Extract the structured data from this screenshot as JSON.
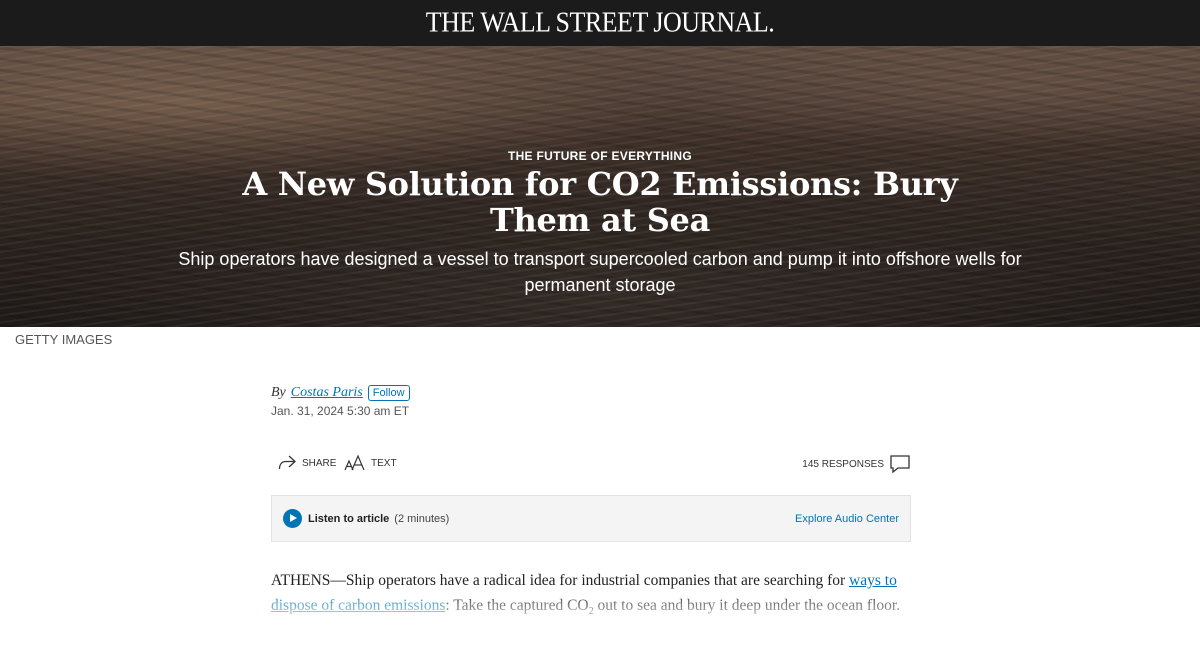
{
  "masthead": {
    "logo": "THE WALL STREET JOURNAL."
  },
  "hero": {
    "flashline": "THE FUTURE OF EVERYTHING",
    "headline": "A New Solution for CO2 Emissions: Bury Them at Sea",
    "dek": "Ship operators have designed a vessel to transport supercooled carbon and pump it into offshore wells for permanent storage",
    "credit": "GETTY IMAGES"
  },
  "byline": {
    "prefix": "By",
    "author": "Costas Paris",
    "follow_label": "Follow",
    "timestamp": "Jan. 31, 2024 5:30 am ET"
  },
  "toolbar": {
    "share_label": "SHARE",
    "text_label": "TEXT",
    "responses_label": "145 RESPONSES"
  },
  "audio": {
    "listen_label": "Listen to article",
    "duration": "(2 minutes)",
    "explore_label": "Explore Audio Center"
  },
  "body": {
    "intro": "ATHENS—Ship operators have a radical idea for industrial companies that are searching for ",
    "link_text": "ways to dispose of carbon emissions",
    "after_link": ": Take the captured CO",
    "subscript": "2",
    "ending": " out to sea and bury it deep under the ocean floor."
  },
  "colors": {
    "accent": "#0274b6",
    "masthead_bg": "#1b1b1b"
  }
}
